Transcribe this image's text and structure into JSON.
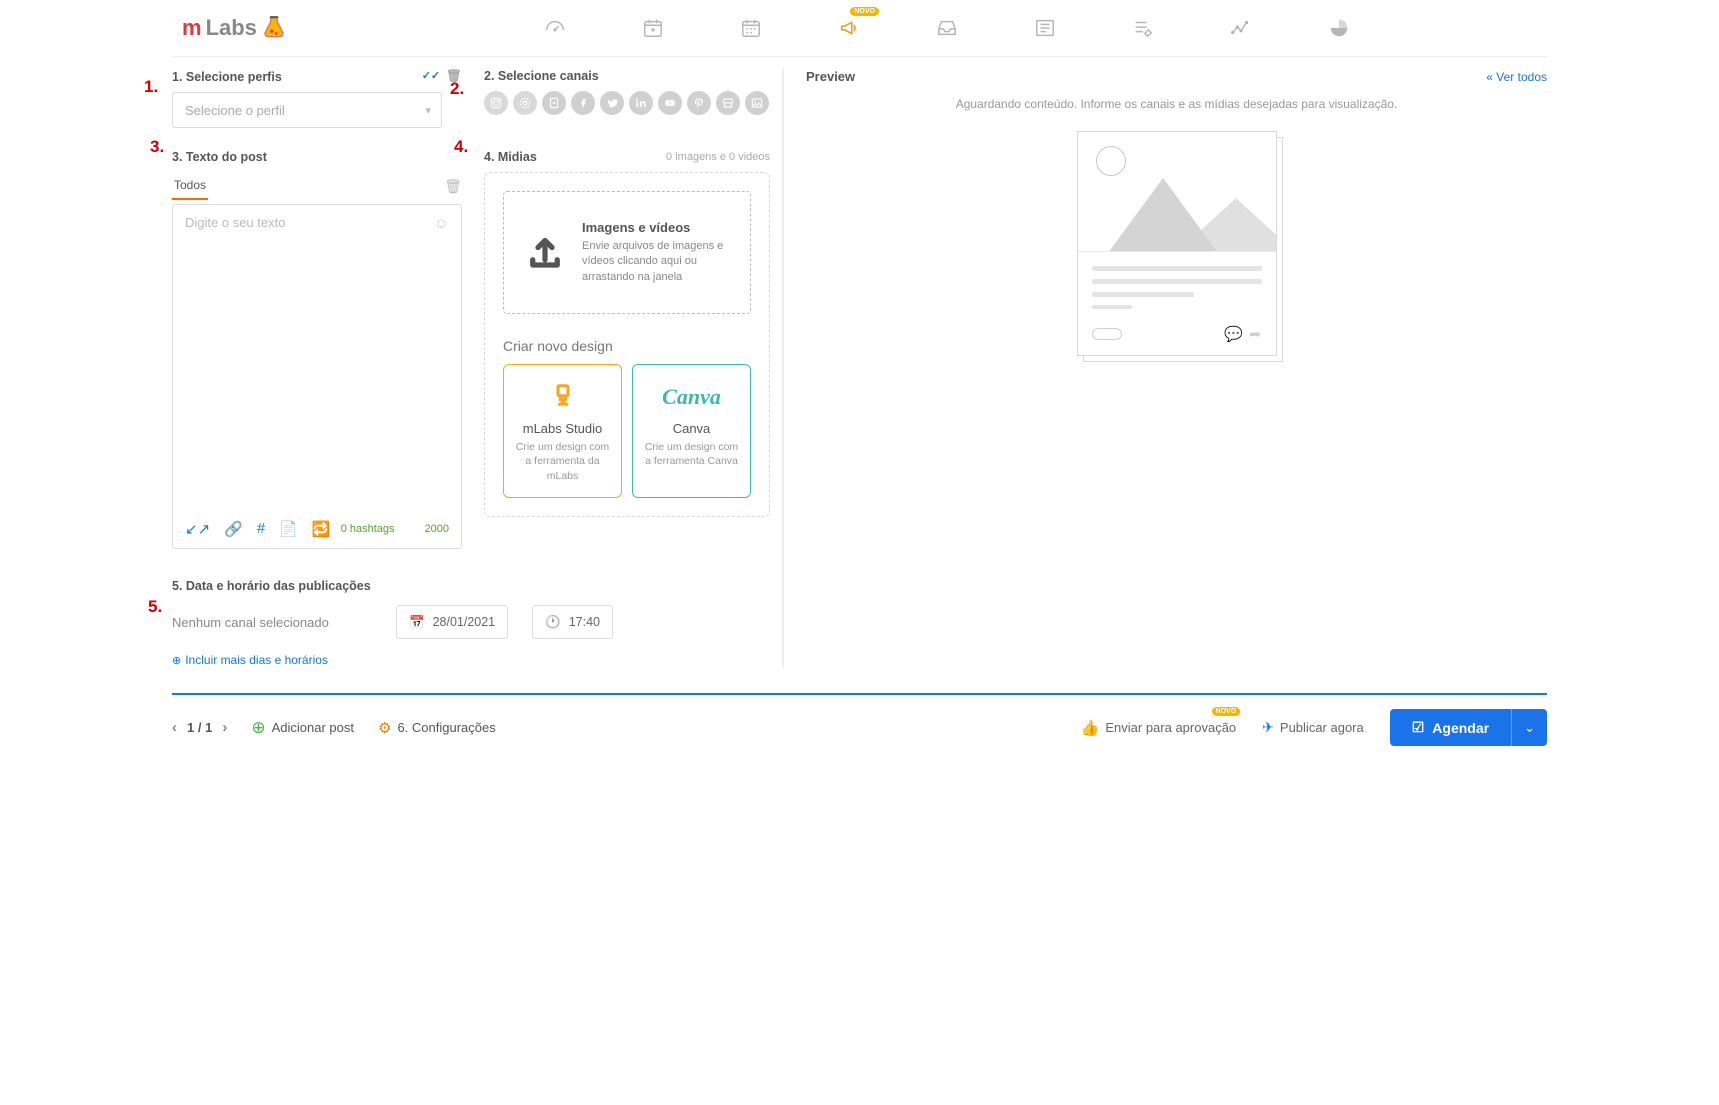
{
  "logo_m": "m",
  "logo_labs": "Labs",
  "badge_novo": "NOVO",
  "callouts": {
    "c1": "1.",
    "c2": "2.",
    "c3": "3.",
    "c4": "4.",
    "c5": "5."
  },
  "section": {
    "profiles_label": "1. Selecione perfis",
    "channels_label": "2. Selecione canais",
    "text_label": "3. Texto do post",
    "media_label": "4. Midias",
    "schedule_label": "5. Data e horário das publicações"
  },
  "profile_select_placeholder": "Selecione o perfil",
  "text_tab": "Todos",
  "text_placeholder": "Digite o seu texto",
  "hashtag_count": "0 hashtags",
  "char_count": "2000",
  "media_count": "0 imagens e 0 videos",
  "upload": {
    "title": "Imagens e vídeos",
    "desc": "Envie arquivos de imagens e vídeos clicando aqui ou arrastando na janela"
  },
  "design_label": "Criar novo design",
  "design_cards": {
    "mlabs": {
      "title": "mLabs Studio",
      "desc": "Crie um design com a ferramenta da mLabs"
    },
    "canva": {
      "logo": "Canva",
      "title": "Canva",
      "desc": "Crie um design com a ferramenta Canva"
    }
  },
  "schedule": {
    "no_channel": "Nenhum canal selecionado",
    "date": "28/01/2021",
    "time": "17:40",
    "add_more": "Incluir mais dias e horários"
  },
  "preview": {
    "title": "Preview",
    "see_all": "« Ver todos",
    "waiting": "Aguardando conteúdo. Informe os canais e as mídias desejadas para visualização."
  },
  "bottom": {
    "pager_current": "1",
    "pager_total": "1",
    "pager_sep": "/",
    "add_post": "Adicionar post",
    "config": "6. Configurações",
    "send_approval": "Enviar para aprovação",
    "publish_now": "Publicar agora",
    "schedule_btn": "Agendar"
  }
}
